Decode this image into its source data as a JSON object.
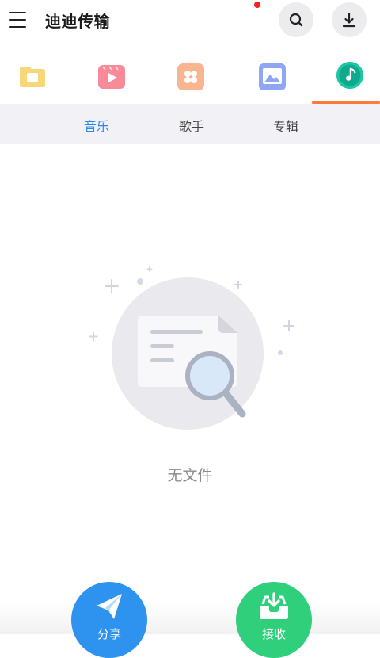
{
  "app": {
    "title": "迪迪传输"
  },
  "header": {
    "has_notification": true
  },
  "category_tabs": [
    {
      "name": "files",
      "icon": "folder-icon",
      "color": "#f8d778",
      "selected": false
    },
    {
      "name": "videos",
      "icon": "video-play-icon",
      "color": "#f98b99",
      "selected": false
    },
    {
      "name": "apps",
      "icon": "apps-grid-icon",
      "color": "#f8a97a",
      "selected": false
    },
    {
      "name": "images",
      "icon": "image-icon",
      "color": "#8ea6f3",
      "selected": false
    },
    {
      "name": "music",
      "icon": "music-note-icon",
      "color": "#1ec6a6",
      "selected": true
    }
  ],
  "sub_tabs": [
    {
      "label": "音乐",
      "active": true
    },
    {
      "label": "歌手",
      "active": false
    },
    {
      "label": "专辑",
      "active": false
    }
  ],
  "empty_state": {
    "text": "无文件",
    "icon": "empty-file-search-icon"
  },
  "actions": {
    "share_label": "分享",
    "receive_label": "接收"
  },
  "colors": {
    "accent": "#2b8ae6",
    "tab_underline": "#ff7a3d",
    "share": "#2e93ee",
    "receive": "#2fcf7c"
  }
}
